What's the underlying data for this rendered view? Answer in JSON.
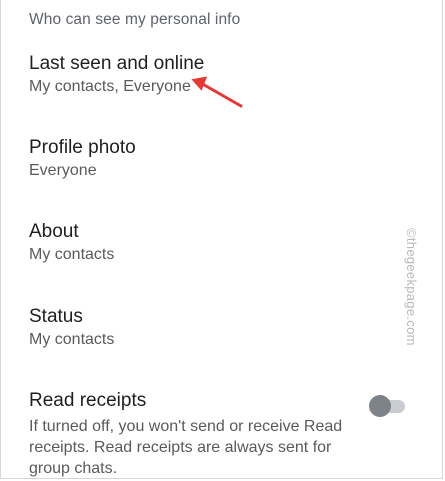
{
  "section": {
    "header": "Who can see my personal info"
  },
  "items": [
    {
      "title": "Last seen and online",
      "subtitle": "My contacts, Everyone"
    },
    {
      "title": "Profile photo",
      "subtitle": "Everyone"
    },
    {
      "title": "About",
      "subtitle": "My contacts"
    },
    {
      "title": "Status",
      "subtitle": "My contacts"
    }
  ],
  "read_receipts": {
    "title": "Read receipts",
    "description": "If turned off, you won't send or receive Read receipts. Read receipts are always sent for group chats.",
    "enabled": false
  },
  "watermark": "©thegeekpage.com",
  "colors": {
    "annotation_arrow": "#e53935",
    "toggle_thumb_off": "#7d8388",
    "toggle_track_off": "#c9cdd1"
  },
  "icons": {
    "annotation": "arrow-icon",
    "toggle": "toggle-switch"
  }
}
